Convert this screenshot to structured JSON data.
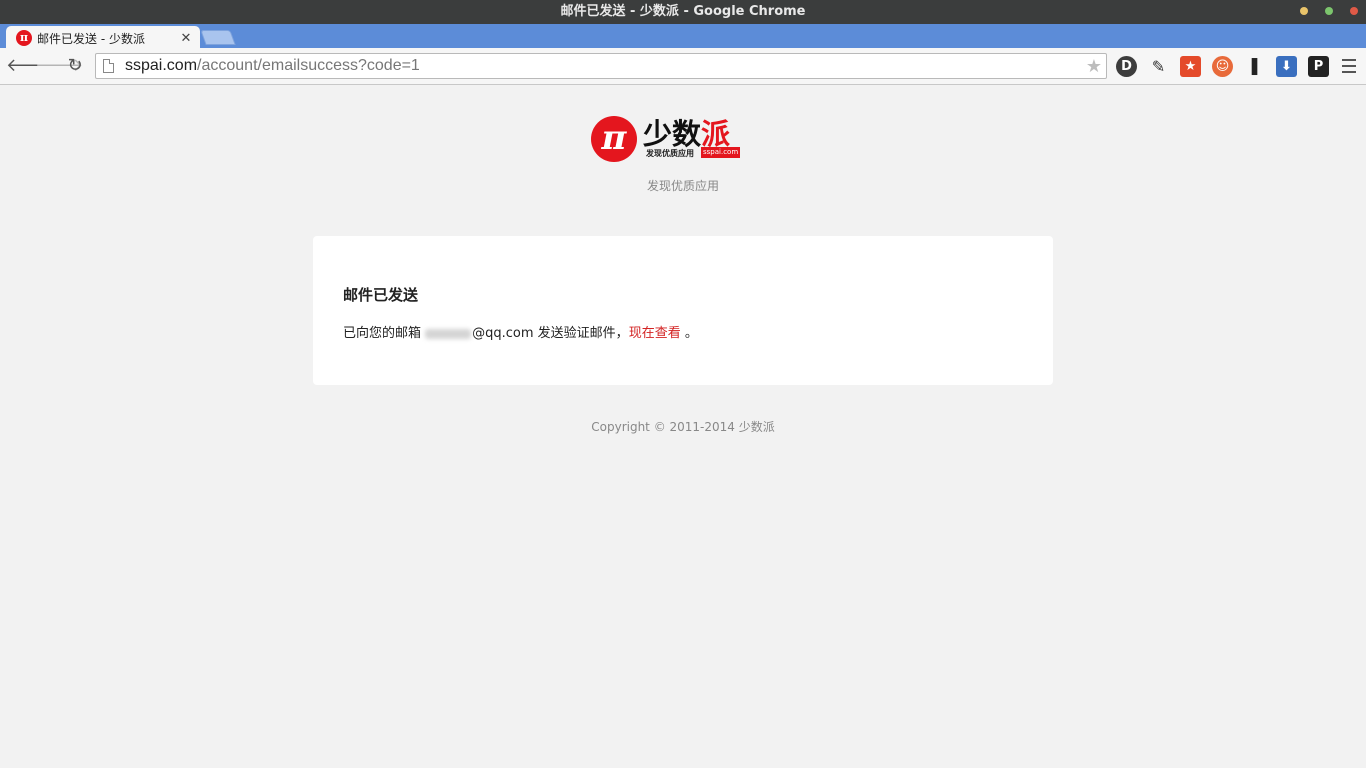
{
  "window": {
    "title": "邮件已发送 - 少数派 - Google Chrome"
  },
  "tabs": [
    {
      "label": "邮件已发送 - 少数派",
      "favicon": "π"
    }
  ],
  "toolbar": {
    "url_host": "sspai.com",
    "url_path": "/account/emailsuccess?code=1"
  },
  "extensions": [
    {
      "name": "ext-1-icon",
      "glyph": "D"
    },
    {
      "name": "ext-2-icon",
      "glyph": "✎"
    },
    {
      "name": "ext-3-icon",
      "glyph": "★"
    },
    {
      "name": "ext-4-icon",
      "glyph": "☺"
    },
    {
      "name": "ext-5-icon",
      "glyph": "❚"
    },
    {
      "name": "ext-6-icon",
      "glyph": "⬇"
    },
    {
      "name": "ext-7-icon",
      "glyph": "P"
    }
  ],
  "logo": {
    "mark": "π",
    "name_part1": "少数",
    "name_part2": "派",
    "sub": "发现优质应用",
    "domain": "sspai.com"
  },
  "tagline": "发现优质应用",
  "card": {
    "title": "邮件已发送",
    "msg_prefix": "已向您的邮箱 ",
    "email_domain": "@qq.com",
    "msg_middle": " 发送验证邮件，",
    "link_label": "现在查看",
    "msg_suffix": " 。"
  },
  "footer": {
    "copyright": "Copyright © 2011-2014 少数派"
  },
  "colors": {
    "brand_red": "#e4161e",
    "link_red": "#d32323",
    "tab_strip_blue": "#5c8cd8",
    "page_bg": "#f2f2f2"
  }
}
